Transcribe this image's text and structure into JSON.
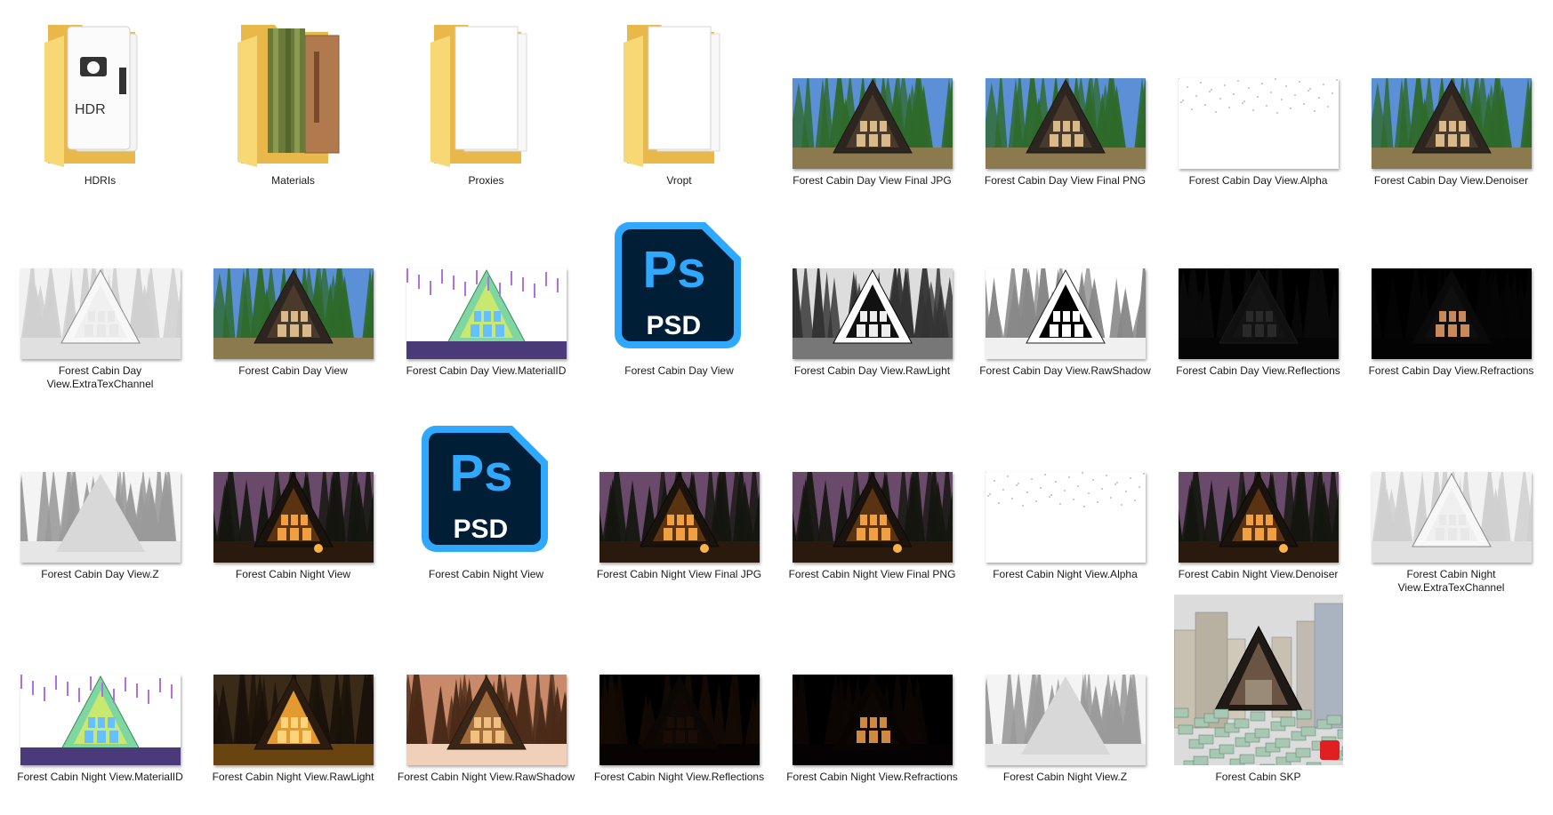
{
  "folders": [
    {
      "name": "HDRIs",
      "glyph": "HDR",
      "icon": "hdr-folder-icon"
    },
    {
      "name": "Materials",
      "icon": "materials-folder-icon"
    },
    {
      "name": "Proxies",
      "icon": "folder-icon"
    },
    {
      "name": "Vropt",
      "icon": "folder-icon"
    }
  ],
  "psd_badge": "Ps",
  "psd_text": "PSD",
  "skp_badge_icon": "sketchup-icon",
  "colors": {
    "psd_bg": "#001e36",
    "psd_accent": "#31a8ff",
    "folder_yellow": "#f8d775",
    "folder_dark": "#e8b84a"
  },
  "files": [
    {
      "name": "Forest Cabin Day View Final JPG",
      "kind": "day"
    },
    {
      "name": "Forest Cabin Day View Final PNG",
      "kind": "day"
    },
    {
      "name": "Forest Cabin Day View.Alpha",
      "kind": "alpha"
    },
    {
      "name": "Forest Cabin Day View.Denoiser",
      "kind": "day"
    },
    {
      "name": "Forest Cabin Day View.ExtraTexChannel",
      "kind": "extratex"
    },
    {
      "name": "Forest Cabin Day View",
      "kind": "day"
    },
    {
      "name": "Forest Cabin Day View.MaterialID",
      "kind": "materialid"
    },
    {
      "name": "Forest Cabin Day View",
      "kind": "psd"
    },
    {
      "name": "Forest Cabin Day View.RawLight",
      "kind": "rawlight-day"
    },
    {
      "name": "Forest Cabin Day View.RawShadow",
      "kind": "rawshadow-day"
    },
    {
      "name": "Forest Cabin Day View.Reflections",
      "kind": "reflections"
    },
    {
      "name": "Forest Cabin Day View.Refractions",
      "kind": "refractions"
    },
    {
      "name": "Forest Cabin Day View.Z",
      "kind": "zdepth"
    },
    {
      "name": "Forest Cabin Night View",
      "kind": "night"
    },
    {
      "name": "Forest Cabin Night View",
      "kind": "psd"
    },
    {
      "name": "Forest Cabin Night View Final JPG",
      "kind": "night"
    },
    {
      "name": "Forest Cabin Night View Final PNG",
      "kind": "night"
    },
    {
      "name": "Forest Cabin Night View.Alpha",
      "kind": "alpha"
    },
    {
      "name": "Forest Cabin Night View.Denoiser",
      "kind": "night"
    },
    {
      "name": "Forest Cabin Night View.ExtraTexChannel",
      "kind": "extratex"
    },
    {
      "name": "Forest Cabin Night View.MaterialID",
      "kind": "materialid"
    },
    {
      "name": "Forest Cabin Night View.RawLight",
      "kind": "rawlight-night"
    },
    {
      "name": "Forest Cabin Night View.RawShadow",
      "kind": "rawshadow-night"
    },
    {
      "name": "Forest Cabin Night View.Reflections",
      "kind": "reflections-night"
    },
    {
      "name": "Forest Cabin Night View.Refractions",
      "kind": "refractions-night"
    },
    {
      "name": "Forest Cabin Night View.Z",
      "kind": "zdepth"
    },
    {
      "name": "Forest Cabin SKP",
      "kind": "skp"
    }
  ]
}
